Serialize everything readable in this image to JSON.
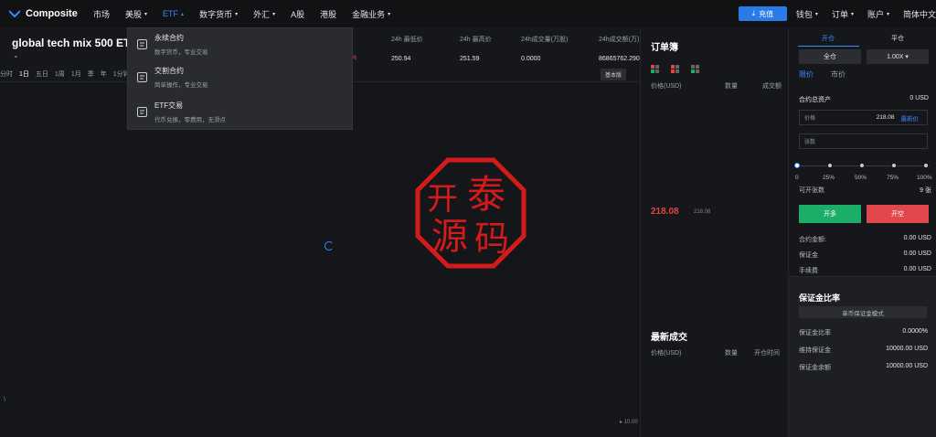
{
  "nav": {
    "logo": "Composite",
    "items": [
      {
        "label": "市场",
        "caret": false,
        "active": false
      },
      {
        "label": "美股",
        "caret": true,
        "active": false
      },
      {
        "label": "ETF",
        "caret": true,
        "active": true
      },
      {
        "label": "数字货币",
        "caret": true,
        "active": false
      },
      {
        "label": "外汇",
        "caret": true,
        "active": false
      },
      {
        "label": "A股",
        "caret": false,
        "active": false
      },
      {
        "label": "港股",
        "caret": false,
        "active": false
      },
      {
        "label": "金融业务",
        "caret": true,
        "active": false
      }
    ],
    "deposit": "充值",
    "wallet": "钱包",
    "orders": "订单",
    "account": "账户",
    "language": "简体中文",
    "accent": "#3a8bff"
  },
  "ticker": {
    "symbol": "global tech mix 500 ETF",
    "change_pct": "%",
    "stats": [
      {
        "label": "24h 最低价",
        "value": "250.94"
      },
      {
        "label": "24h 最高价",
        "value": "251.59"
      },
      {
        "label": "24h成交量(万股)",
        "value": "0.0000"
      },
      {
        "label": "24h成交额(万)",
        "value": "86865762.2900"
      }
    ]
  },
  "dropdown": [
    {
      "title": "永续合约",
      "sub": "数字货币，专业交易",
      "icon": "contract-icon"
    },
    {
      "title": "交割合约",
      "sub": "简单操作，专业交易",
      "icon": "delivery-icon"
    },
    {
      "title": "ETF交易",
      "sub": "代币兑换，零费用，无滑点",
      "icon": "exchange-icon"
    }
  ],
  "timeframes": [
    "分时",
    "1日",
    "五日",
    "1周",
    "1月",
    "季",
    "年",
    "1分钟"
  ],
  "timeframe_active": 1,
  "basic_btn": "基本版",
  "chart": {
    "price_label": "10.00"
  },
  "stamp": {
    "chars": [
      "开",
      "泰",
      "源",
      "码"
    ],
    "color": "#d41b1b"
  },
  "orderbook": {
    "title": "订单簿",
    "headers": [
      "价格(USD)",
      "数量",
      "成交额"
    ],
    "last_price": "218.08",
    "last_sub": "218.08"
  },
  "trades": {
    "title": "最新成交",
    "headers": [
      "价格(USD)",
      "数量",
      "开仓时间"
    ]
  },
  "panel": {
    "tab_open": "开仓",
    "tab_close": "平仓",
    "mode": "全仓",
    "leverage": "1.00X ▾",
    "limit": "限价",
    "market": "市价",
    "total_label": "合约总资产",
    "total_value": "0 USD",
    "price_label": "价格",
    "price_value": "218.08",
    "latest_price": "最新价",
    "qty_placeholder": "张数",
    "percents": [
      "0",
      "25%",
      "50%",
      "75%",
      "100%"
    ],
    "open_qty_label": "可开张数",
    "open_qty_value": "9 张",
    "open_btn": "开多",
    "close_btn": "开空",
    "contract_amount_label": "合约金额:",
    "contract_amount_value": "0.00 USD",
    "margin_label": "保证金",
    "margin_value": "0.00 USD",
    "fee_label": "手续费",
    "fee_value": "0.00 USD"
  },
  "margin": {
    "title": "保证金比率",
    "mode": "单币保证金模式",
    "ratio_label": "保证金比率",
    "ratio_value": "0.0000%",
    "maint_label": "维持保证金",
    "maint_value": "10000.00 USD",
    "balance_label": "保证金余额",
    "balance_value": "10000.00 USD"
  }
}
